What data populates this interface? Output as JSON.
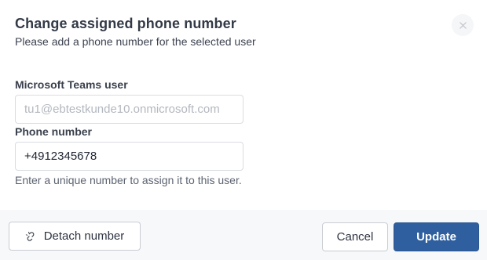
{
  "dialog": {
    "title": "Change assigned phone number",
    "subtitle": "Please add a phone number for the selected user",
    "close_icon": "close-icon"
  },
  "form": {
    "teams_user": {
      "label": "Microsoft Teams user",
      "placeholder": "tu1@ebtestkunde10.onmicrosoft.com",
      "value": ""
    },
    "phone_number": {
      "label": "Phone number",
      "value": "+4912345678",
      "helper": "Enter a unique number to assign it to this user."
    }
  },
  "footer": {
    "detach_label": "Detach number",
    "detach_icon": "unlink-icon",
    "cancel_label": "Cancel",
    "update_label": "Update"
  },
  "colors": {
    "primary": "#2f5f9e",
    "footer_bg": "#f7f8fa",
    "border": "#d9dce1"
  }
}
